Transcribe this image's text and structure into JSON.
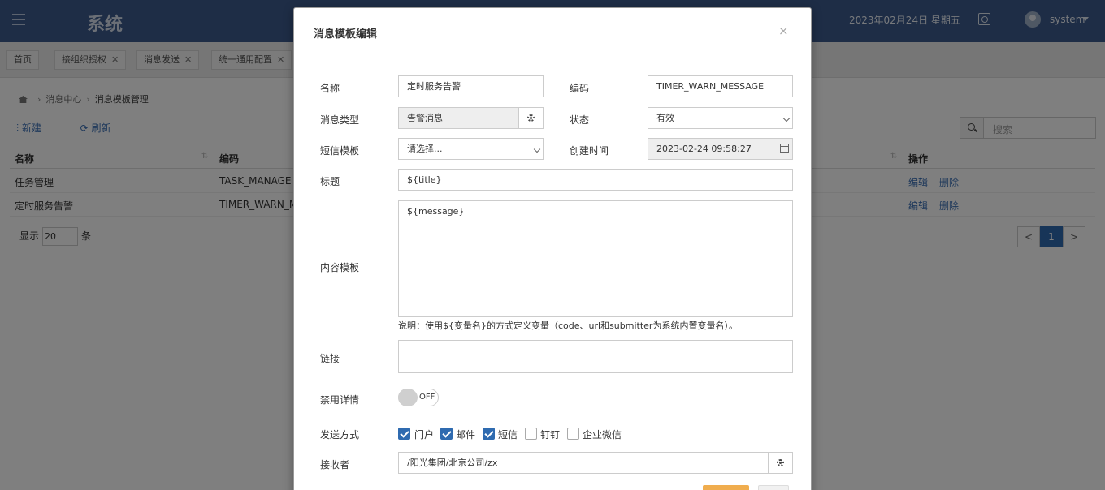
{
  "app": {
    "title": "系统",
    "date": "2023年02月24日 星期五",
    "user": "system"
  },
  "tabs": [
    {
      "label": "首页"
    },
    {
      "label": "接组织授权"
    },
    {
      "label": "消息发送"
    },
    {
      "label": "统一通用配置"
    }
  ],
  "breadcrumb": {
    "level1": "消息中心",
    "current": "消息模板管理"
  },
  "toolbar": {
    "new_label": "新建",
    "refresh_label": "刷新"
  },
  "search": {
    "placeholder": "搜索"
  },
  "table": {
    "columns": {
      "name": "名称",
      "code": "编码",
      "actions": "操作"
    },
    "rows": [
      {
        "name": "任务管理",
        "code": "TASK_MANAGE",
        "edit": "编辑",
        "delete": "删除"
      },
      {
        "name": "定时服务告警",
        "code": "TIMER_WARN_ME",
        "edit": "编辑",
        "delete": "删除"
      }
    ]
  },
  "page_size": {
    "prefix": "显示",
    "value": "20",
    "suffix": "条"
  },
  "pagination": {
    "prev": "<",
    "current": "1",
    "next": ">"
  },
  "modal": {
    "title": "消息模板编辑",
    "close": "×",
    "labels": {
      "name": "名称",
      "code": "编码",
      "msg_type": "消息类型",
      "status": "状态",
      "sms_template": "短信模板",
      "created_time": "创建时间",
      "subject": "标题",
      "content": "内容模板",
      "link": "链接",
      "disable_detail": "禁用详情",
      "send_method": "发送方式",
      "receiver": "接收者"
    },
    "values": {
      "name": "定时服务告警",
      "code": "TIMER_WARN_MESSAGE",
      "msg_type": "告警消息",
      "status": "有效",
      "sms_template": "请选择...",
      "created_time": "2023-02-24 09:58:27",
      "subject": "${title}",
      "content": "${message}",
      "link": "",
      "receiver": "/阳光集团/北京公司/zx"
    },
    "hint": "说明：使用${变量名}的方式定义变量（code、url和submitter为系统内置变量名）。",
    "toggle_label": "OFF",
    "toggle_on": false,
    "send_methods": [
      {
        "label": "门户",
        "checked": true
      },
      {
        "label": "邮件",
        "checked": true
      },
      {
        "label": "短信",
        "checked": true
      },
      {
        "label": "钉钉",
        "checked": false
      },
      {
        "label": "企业微信",
        "checked": false
      }
    ],
    "colors": {
      "primary": "#2f6bb0",
      "save": "#f0ad4e"
    }
  }
}
